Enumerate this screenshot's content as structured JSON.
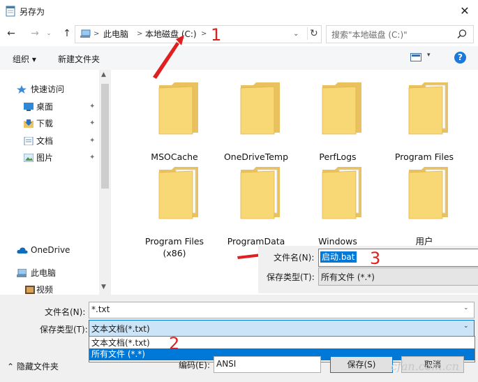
{
  "window": {
    "title": "另存为",
    "close_glyph": "✕"
  },
  "nav": {
    "back_glyph": "←",
    "forward_glyph": "→",
    "up_glyph": "↑",
    "dropdown_glyph": "⌄",
    "breadcrumbs": [
      "此电脑",
      "本地磁盘 (C:)"
    ],
    "crumb_sep": ">",
    "refresh_glyph": "↻",
    "search_placeholder": "搜索\"本地磁盘 (C:)\""
  },
  "toolbar": {
    "organize": "组织 ▾",
    "new_folder": "新建文件夹",
    "view_drop": "▾",
    "help": "?"
  },
  "sidebar": {
    "items": [
      {
        "label": "快速访问",
        "icon": "star-icon"
      },
      {
        "label": "桌面",
        "icon": "desktop-icon",
        "pinned": true
      },
      {
        "label": "下载",
        "icon": "download-icon",
        "pinned": true
      },
      {
        "label": "文档",
        "icon": "document-icon",
        "pinned": true
      },
      {
        "label": "图片",
        "icon": "pictures-icon",
        "pinned": true
      },
      {
        "label": "OneDrive",
        "icon": "cloud-icon"
      },
      {
        "label": "此电脑",
        "icon": "computer-icon"
      },
      {
        "label": "视频",
        "icon": "video-icon"
      }
    ],
    "pin_glyph": "📌"
  },
  "folders": [
    {
      "name": "MSOCache",
      "has_docs": false
    },
    {
      "name": "OneDriveTemp",
      "has_docs": false
    },
    {
      "name": "PerfLogs",
      "has_docs": false
    },
    {
      "name": "Program Files",
      "has_docs": true
    },
    {
      "name": "Program Files\n(x86)",
      "has_docs": true
    },
    {
      "name": "ProgramData",
      "has_docs": true
    },
    {
      "name": "Windows",
      "has_docs": true
    },
    {
      "name": "用户",
      "has_docs": true
    }
  ],
  "rename_panel": {
    "filename_label": "文件名(N):",
    "filename_value": "启动.bat",
    "type_label": "保存类型(T):",
    "type_value": "所有文件  (*.*)"
  },
  "form": {
    "filename_label": "文件名(N):",
    "filename_value": "*.txt",
    "type_label": "保存类型(T):",
    "type_value": "文本文档(*.txt)",
    "type_options": [
      "文本文档(*.txt)",
      "所有文件  (*.*)"
    ],
    "hide_folders": "⌃ 隐藏文件夹",
    "encoding_label": "编码(E):",
    "encoding_value": "ANSI",
    "save": "保存(S)",
    "cancel": "取消"
  },
  "annotations": {
    "n1": "1",
    "n2": "2",
    "n3": "3",
    "color": "#e02020"
  },
  "watermark": "cfan.com.cn"
}
